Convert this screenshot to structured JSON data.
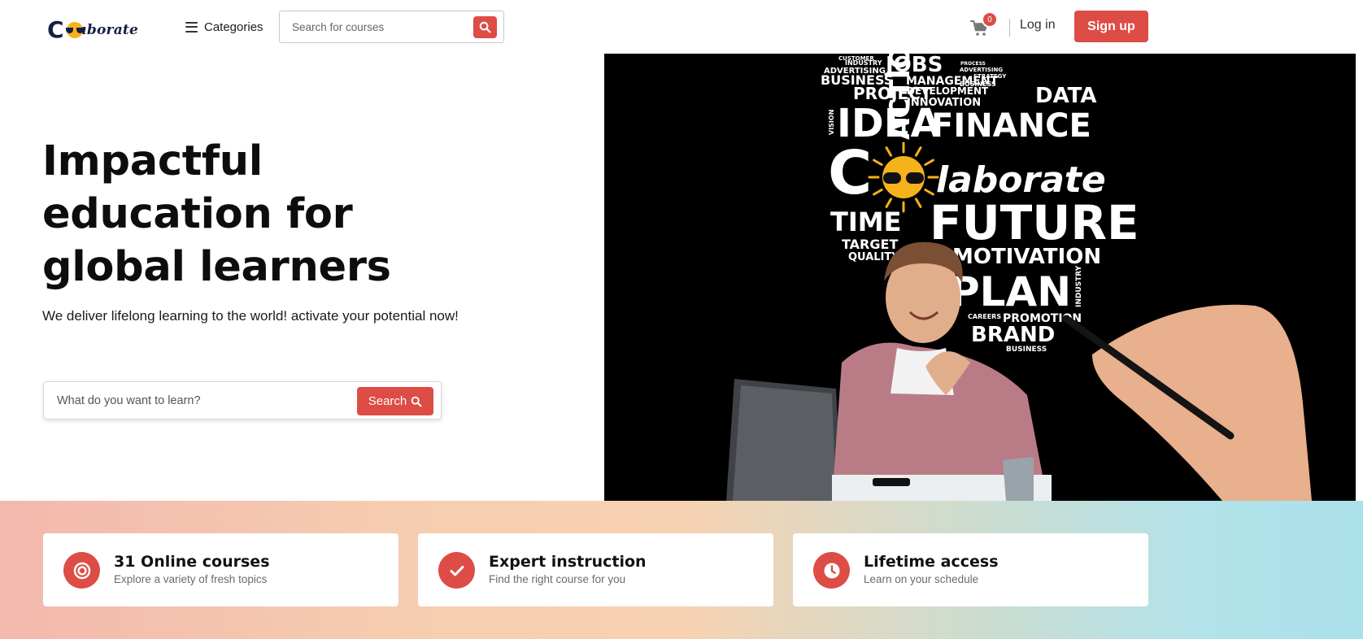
{
  "brand": {
    "logo_prefix": "C",
    "logo_suffix": "laborate",
    "accent": "#dd4c45",
    "navy": "#151f45"
  },
  "header": {
    "categories_label": "Categories",
    "search_placeholder": "Search for courses",
    "cart_count": "0",
    "login_label": "Log in",
    "signup_label": "Sign up"
  },
  "hero": {
    "title_line1": "Impactful",
    "title_line2": "education for",
    "title_line3": "global learners",
    "subtitle": "We deliver lifelong learning to the world! activate your potential now!",
    "search_placeholder": "What do you want to learn?",
    "search_button": "Search"
  },
  "hero_image": {
    "logo_prefix": "C",
    "logo_suffix": "laborate",
    "words_top": {
      "jobs": "JOBS",
      "business": "BUSINESS",
      "management": "MANAGEMENT",
      "project": "PROJECT",
      "development": "DEVELOPMENT",
      "data": "DATA",
      "innovation": "INNOVATION",
      "idea": "IDEA",
      "action": "ACTION",
      "finance": "FINANCE",
      "advertising": "ADVERTISING",
      "industry": "INDUSTRY",
      "customer": "CUSTOMER",
      "process": "PROCESS",
      "strategy": "STRATEGY",
      "vision": "VISION"
    },
    "words_bottom": {
      "time": "TIME",
      "future": "FUTURE",
      "target": "TARGET",
      "quality": "QUALITY",
      "motivation": "MOTIVATION",
      "plan": "PLAN",
      "careers": "CAREERS",
      "promotion": "PROMOTION",
      "brand": "BRAND",
      "business": "BUSINESS",
      "industry": "INDUSTRY"
    }
  },
  "features": [
    {
      "icon": "target-icon",
      "title": "31 Online courses",
      "subtitle": "Explore a variety of fresh topics"
    },
    {
      "icon": "check-icon",
      "title": "Expert instruction",
      "subtitle": "Find the right course for you"
    },
    {
      "icon": "clock-icon",
      "title": "Lifetime access",
      "subtitle": "Learn on your schedule"
    }
  ]
}
